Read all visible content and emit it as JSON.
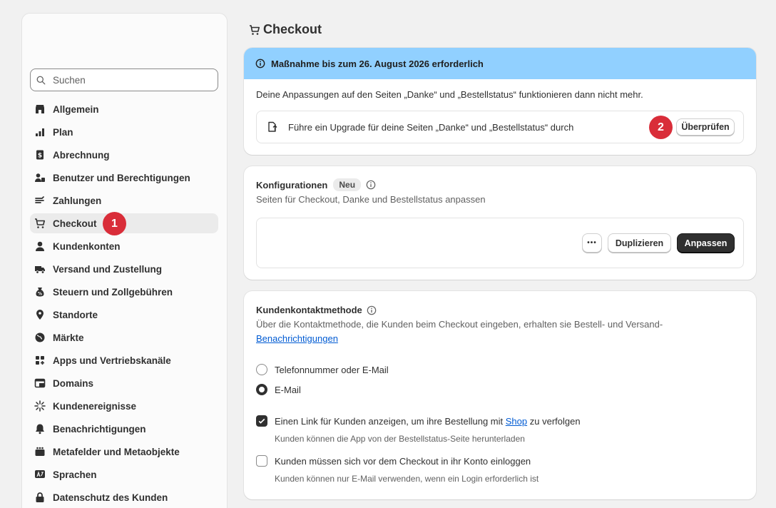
{
  "sidebar": {
    "search_placeholder": "Suchen",
    "items": [
      {
        "label": "Allgemein",
        "icon": "store-icon"
      },
      {
        "label": "Plan",
        "icon": "plan-icon"
      },
      {
        "label": "Abrechnung",
        "icon": "billing-icon"
      },
      {
        "label": "Benutzer und Berechtigungen",
        "icon": "users-icon"
      },
      {
        "label": "Zahlungen",
        "icon": "payments-icon"
      },
      {
        "label": "Checkout",
        "icon": "cart-icon"
      },
      {
        "label": "Kundenkonten",
        "icon": "person-icon"
      },
      {
        "label": "Versand und Zustellung",
        "icon": "truck-icon"
      },
      {
        "label": "Steuern und Zollgebühren",
        "icon": "tax-icon"
      },
      {
        "label": "Standorte",
        "icon": "location-icon"
      },
      {
        "label": "Märkte",
        "icon": "globe-icon"
      },
      {
        "label": "Apps und Vertriebskanäle",
        "icon": "apps-icon"
      },
      {
        "label": "Domains",
        "icon": "domains-icon"
      },
      {
        "label": "Kundenereignisse",
        "icon": "events-icon"
      },
      {
        "label": "Benachrichtigungen",
        "icon": "bell-icon"
      },
      {
        "label": "Metafelder und Metaobjekte",
        "icon": "metafields-icon"
      },
      {
        "label": "Sprachen",
        "icon": "languages-icon"
      },
      {
        "label": "Datenschutz des Kunden",
        "icon": "lock-icon"
      }
    ],
    "active_index": 5,
    "step_badge": "1"
  },
  "page": {
    "title": "Checkout"
  },
  "banner": {
    "title": "Maßnahme bis zum 26. August 2026 erforderlich",
    "description": "Deine Anpassungen auf den Seiten „Danke“ und „Bestellstatus“ funktionieren dann nicht mehr.",
    "upgrade_text": "Führe ein Upgrade für deine Seiten „Danke“ und „Bestellstatus“ durch",
    "step_badge": "2",
    "review_button": "Überprüfen",
    "color": "#91d0ff"
  },
  "config": {
    "title": "Konfigurationen",
    "badge": "Neu",
    "subtitle": "Seiten für Checkout, Danke und Bestellstatus anpassen",
    "more_button": "•••",
    "duplicate_button": "Duplizieren",
    "customize_button": "Anpassen"
  },
  "contact": {
    "title": "Kundenkontaktmethode",
    "description": "Über die Kontaktmethode, die Kunden beim Checkout eingeben, erhalten sie Bestell- und Versand-",
    "link": "Benachrichtigungen",
    "options": [
      "Telefonnummer oder E-Mail",
      "E-Mail"
    ],
    "selected_index": 1,
    "checkbox1_label_before": "Einen Link für Kunden anzeigen, um ihre Bestellung mit",
    "checkbox1_link": "Shop",
    "checkbox1_label_after": "zu verfolgen",
    "checkbox1_help": "Kunden können die App von der Bestellstatus-Seite herunterladen",
    "checkbox1_checked": true,
    "checkbox2_label": "Kunden müssen sich vor dem Checkout in ihr Konto einloggen",
    "checkbox2_help": "Kunden können nur E-Mail verwenden, wenn ein Login erforderlich ist",
    "checkbox2_checked": false
  },
  "colors": {
    "accent": "#d92d39",
    "link": "#005bd3",
    "primary_button": "#303030"
  }
}
